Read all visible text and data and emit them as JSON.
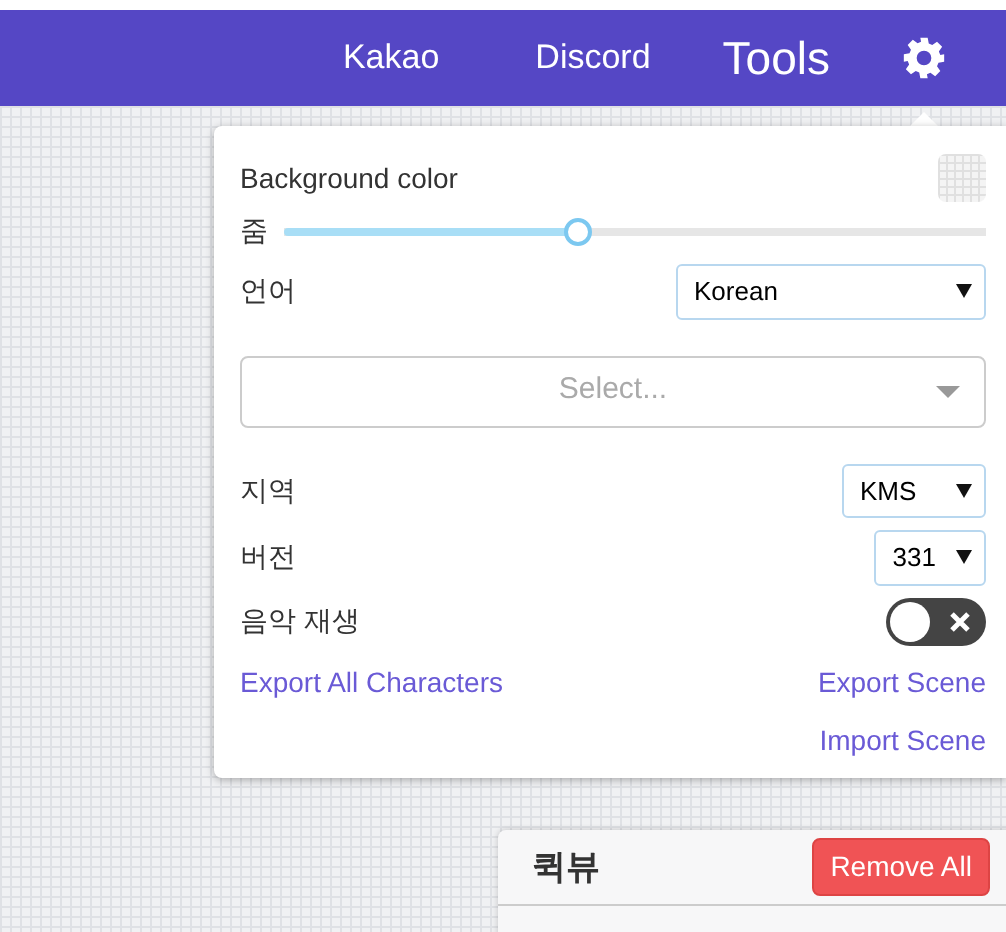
{
  "navbar": {
    "links": [
      {
        "label": "Kakao",
        "selected": false
      },
      {
        "label": "Discord",
        "selected": false
      },
      {
        "label": "Tools",
        "selected": true
      }
    ]
  },
  "settings": {
    "background_label": "Background color",
    "zoom_label": "줌",
    "zoom": {
      "level": 0.42
    },
    "language_label": "언어",
    "language": "Korean",
    "select": {
      "placeholder": "Select..."
    },
    "region_label": "지역",
    "region": "KMS",
    "version_label": "버전",
    "version": "331",
    "music_label": "음악 재생",
    "music": {
      "on": false
    },
    "links": [
      {
        "label": "Export All Characters"
      },
      {
        "label": "Export Scene"
      },
      {
        "label": "Import Scene"
      }
    ]
  },
  "quickview": {
    "title": "퀵뷰",
    "button": "Remove All"
  }
}
